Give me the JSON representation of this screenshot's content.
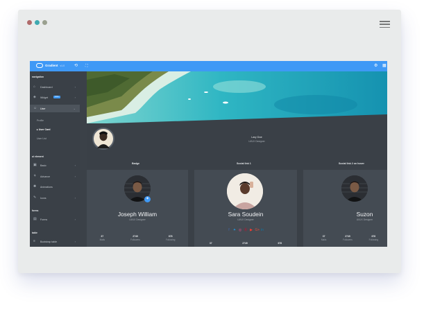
{
  "window": {
    "controls": [
      {
        "name": "close",
        "color": "#b06b6b"
      },
      {
        "name": "minimize",
        "color": "#3ea9b0"
      },
      {
        "name": "maximize",
        "color": "#9aa08f"
      }
    ],
    "menu_icon": "hamburger-menu-icon"
  },
  "topbar": {
    "brand": "Gradient",
    "version": "v1.0",
    "color": "#3f99f6",
    "icons": [
      "sidebar-toggle-icon",
      "expand-icon",
      "settings-icon",
      "grid-icon"
    ]
  },
  "sidebar": {
    "sections": [
      {
        "title": "navigation"
      },
      {
        "title": "ui element"
      },
      {
        "title": "forms"
      },
      {
        "title": "table"
      }
    ],
    "items": [
      {
        "label": "Dashboard",
        "icon": "home-icon"
      },
      {
        "label": "Widget",
        "icon": "layers-icon",
        "badge": "100+"
      },
      {
        "label": "User",
        "icon": "user-icon",
        "active": true
      },
      {
        "label": "Basic",
        "icon": "box-icon"
      },
      {
        "label": "Advance",
        "icon": "gitlab-icon"
      },
      {
        "label": "Animations",
        "icon": "aperture-icon"
      },
      {
        "label": "Icons",
        "icon": "feather-icon"
      },
      {
        "label": "Forms",
        "icon": "file-text-icon"
      },
      {
        "label": "Bootstrap table",
        "icon": "server-icon"
      }
    ],
    "sub_items": [
      {
        "label": "Profile"
      },
      {
        "label": "User Card",
        "active": true
      },
      {
        "label": "User List"
      }
    ]
  },
  "profile": {
    "name": "Lary Doe",
    "role": "UI/UX Designer"
  },
  "sections": {
    "badge": "Badge",
    "social": "Social link 1",
    "social_hover": "Social link 2 on hover"
  },
  "cards": [
    {
      "name": "Joseph William",
      "role": "UI/UX Designer",
      "stats": [
        {
          "value": "37",
          "label": "Mails"
        },
        {
          "value": "2749",
          "label": "Followers"
        },
        {
          "value": "678",
          "label": "Following"
        }
      ]
    },
    {
      "name": "Sara Soudein",
      "role": "UI/UX Designer",
      "stats": [
        {
          "value": "37",
          "label": "Mails"
        },
        {
          "value": "2749",
          "label": "Followers"
        },
        {
          "value": "678",
          "label": "Following"
        }
      ]
    },
    {
      "name": "Suzon",
      "role": "UI/UX Designer",
      "stats": [
        {
          "value": "37",
          "label": "Mails"
        },
        {
          "value": "2749",
          "label": "Followers"
        },
        {
          "value": "678",
          "label": "Following"
        }
      ]
    }
  ],
  "social_icons": [
    "facebook-icon",
    "twitter-icon",
    "dribbble-icon",
    "pinterest-icon",
    "youtube-icon",
    "googleplus-icon",
    "linkedin-icon"
  ]
}
